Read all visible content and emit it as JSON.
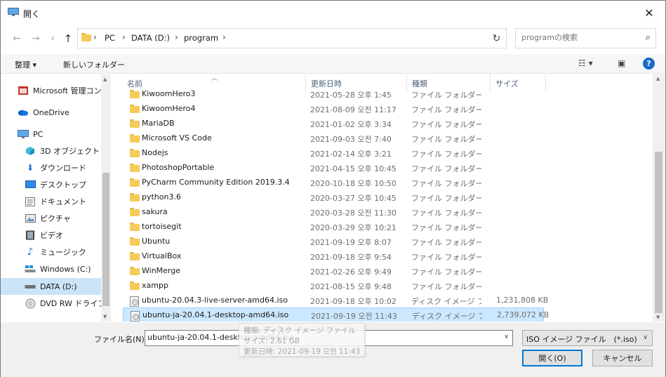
{
  "window": {
    "title": "開く"
  },
  "nav": {
    "breadcrumbs": [
      "PC",
      "DATA (D:)",
      "program"
    ],
    "search_placeholder": "programの検索"
  },
  "toolbar": {
    "organize_label": "整理 ▾",
    "new_folder_label": "新しいフォルダー"
  },
  "sidebar": {
    "items": [
      {
        "label": "Microsoft 管理コン",
        "icon": "mmc-icon"
      },
      {
        "label": "OneDrive",
        "icon": "cloud-icon"
      },
      {
        "label": "PC",
        "icon": "pc-icon"
      },
      {
        "label": "3D オブジェクト",
        "icon": "cube-icon"
      },
      {
        "label": "ダウンロード",
        "icon": "download-icon"
      },
      {
        "label": "デスクトップ",
        "icon": "desktop-icon"
      },
      {
        "label": "ドキュメント",
        "icon": "document-icon"
      },
      {
        "label": "ピクチャ",
        "icon": "picture-icon"
      },
      {
        "label": "ビデオ",
        "icon": "video-icon"
      },
      {
        "label": "ミュージック",
        "icon": "music-icon"
      },
      {
        "label": "Windows (C:)",
        "icon": "drive-icon"
      },
      {
        "label": "DATA (D:)",
        "icon": "drive-icon",
        "selected": true
      },
      {
        "label": "DVD RW ドライブ (",
        "icon": "dvd-icon"
      }
    ]
  },
  "columns": {
    "name": "名前",
    "date": "更新日時",
    "type": "種類",
    "size": "サイズ"
  },
  "files": [
    {
      "name": "KiwoomHero3",
      "date": "2021-05-28 오후 1:45",
      "type": "ファイル フォルダー",
      "size": "",
      "kind": "folder"
    },
    {
      "name": "KiwoomHero4",
      "date": "2021-08-09 오전 11:17",
      "type": "ファイル フォルダー",
      "size": "",
      "kind": "folder"
    },
    {
      "name": "MariaDB",
      "date": "2021-01-02 오후 3:34",
      "type": "ファイル フォルダー",
      "size": "",
      "kind": "folder"
    },
    {
      "name": "Microsoft VS Code",
      "date": "2021-09-03 오전 7:40",
      "type": "ファイル フォルダー",
      "size": "",
      "kind": "folder"
    },
    {
      "name": "Nodejs",
      "date": "2021-02-14 오후 3:21",
      "type": "ファイル フォルダー",
      "size": "",
      "kind": "folder"
    },
    {
      "name": "PhotoshopPortable",
      "date": "2021-04-15 오후 10:45",
      "type": "ファイル フォルダー",
      "size": "",
      "kind": "folder"
    },
    {
      "name": "PyCharm Community Edition 2019.3.4",
      "date": "2020-10-18 오후 10:50",
      "type": "ファイル フォルダー",
      "size": "",
      "kind": "folder"
    },
    {
      "name": "python3.6",
      "date": "2020-03-27 오후 10:45",
      "type": "ファイル フォルダー",
      "size": "",
      "kind": "folder"
    },
    {
      "name": "sakura",
      "date": "2020-03-28 오전 11:30",
      "type": "ファイル フォルダー",
      "size": "",
      "kind": "folder"
    },
    {
      "name": "tortoisegit",
      "date": "2020-03-29 오후 10:21",
      "type": "ファイル フォルダー",
      "size": "",
      "kind": "folder"
    },
    {
      "name": "Ubuntu",
      "date": "2021-09-19 오후 8:07",
      "type": "ファイル フォルダー",
      "size": "",
      "kind": "folder"
    },
    {
      "name": "VirtualBox",
      "date": "2021-09-18 오후 9:54",
      "type": "ファイル フォルダー",
      "size": "",
      "kind": "folder"
    },
    {
      "name": "WinMerge",
      "date": "2021-02-26 오후 9:49",
      "type": "ファイル フォルダー",
      "size": "",
      "kind": "folder"
    },
    {
      "name": "xampp",
      "date": "2021-08-15 오후 9:48",
      "type": "ファイル フォルダー",
      "size": "",
      "kind": "folder"
    },
    {
      "name": "ubuntu-20.04.3-live-server-amd64.iso",
      "date": "2021-09-18 오후 10:02",
      "type": "ディスク イメージ ファ...",
      "size": "1,231,808 KB",
      "kind": "iso"
    },
    {
      "name": "ubuntu-ja-20.04.1-desktop-amd64.iso",
      "date": "2021-09-19 오전 11:43",
      "type": "ディスク イメージ ファ...",
      "size": "2,739,072 KB",
      "kind": "iso",
      "selected": true
    }
  ],
  "tooltip": {
    "line1": "種類: ディスク イメージ ファイル",
    "line2": "サイズ: 2.61 GB",
    "line3": "更新日時: 2021-09-19 오전 11:43"
  },
  "footer": {
    "filename_label": "ファイル名(N):",
    "filename_value": "ubuntu-ja-20.04.1-desktop-amd64.iso",
    "filter_value": "ISO イメージ ファイル　(*.iso)",
    "open_label": "開く(O)",
    "cancel_label": "キャンセル"
  }
}
